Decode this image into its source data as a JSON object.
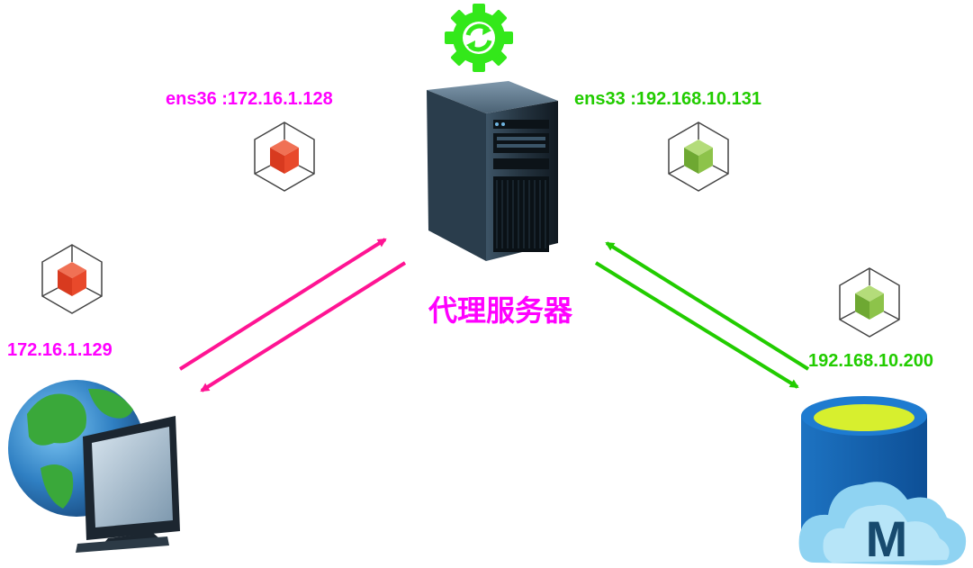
{
  "labels": {
    "ens36": "ens36 :172.16.1.128",
    "ens33": "ens33 :192.168.10.131",
    "client_ip": "172.16.1.129",
    "db_ip": "192.168.10.200",
    "proxy_title": "代理服务器"
  },
  "colors": {
    "pink": "#ff00ff",
    "magenta_arrow": "#ff1493",
    "green": "#22cc00",
    "cube_red": "#e8492b",
    "cube_green": "#8dc34a"
  },
  "icons": {
    "sync": "sync-gear-icon",
    "server": "server-tower-icon",
    "client": "globe-computer-icon",
    "database": "cloud-database-icon",
    "interface": "network-interface-cube-icon"
  },
  "db_icon_letter": "M"
}
